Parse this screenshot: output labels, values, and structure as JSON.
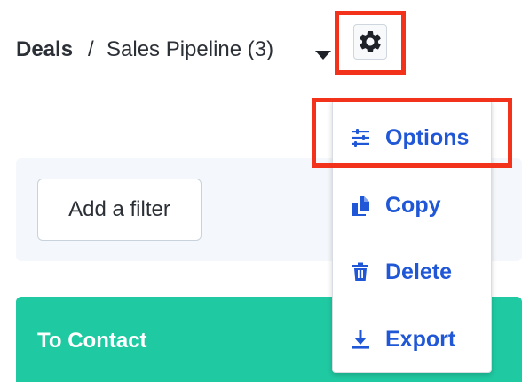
{
  "breadcrumb": {
    "root": "Deals",
    "separator": "/",
    "current": "Sales Pipeline (3)"
  },
  "header": {
    "dropdown_icon": "caret-down-icon",
    "settings_icon": "gear-icon"
  },
  "filters": {
    "add_filter_label": "Add a filter"
  },
  "board": {
    "column_title": "To Contact",
    "column_color": "#1fc9a1"
  },
  "menu": {
    "items": [
      {
        "label": "Options",
        "icon": "sliders-icon"
      },
      {
        "label": "Copy",
        "icon": "copy-icon"
      },
      {
        "label": "Delete",
        "icon": "trash-icon"
      },
      {
        "label": "Export",
        "icon": "download-icon"
      }
    ]
  },
  "colors": {
    "menu_text": "#1f57d6",
    "highlight": "#f2321b",
    "column_header": "#1fc9a1"
  }
}
